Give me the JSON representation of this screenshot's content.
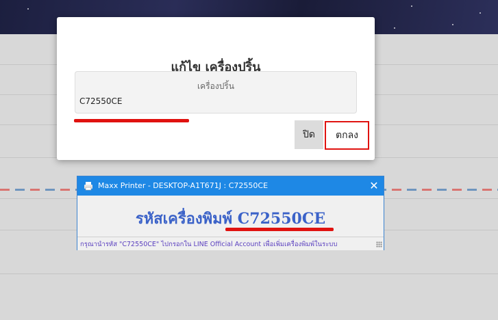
{
  "modal": {
    "title": "แก้ไข เครื่องปริ้น",
    "field_label": "เครื่องปริ้น",
    "field_value": "C72550CE",
    "close_label": "ปิด",
    "ok_label": "ตกลง"
  },
  "printer_window": {
    "title": "Maxx Printer - DESKTOP-A1T671J : C72550CE",
    "icon": "printer-icon",
    "code_text": "รหัสเครื่องพิมพ์ C72550CE",
    "status_text": "กรุณานำรหัส \"C72550CE\" ไปกรอกใน LINE Official Account เพื่อเพิ่มเครื่องพิมพ์ในระบบ"
  },
  "colors": {
    "highlight_red": "#e0120f",
    "titlebar_blue": "#1e88e5",
    "code_blue": "#3b62c8",
    "status_purple": "#5a3fbf"
  }
}
